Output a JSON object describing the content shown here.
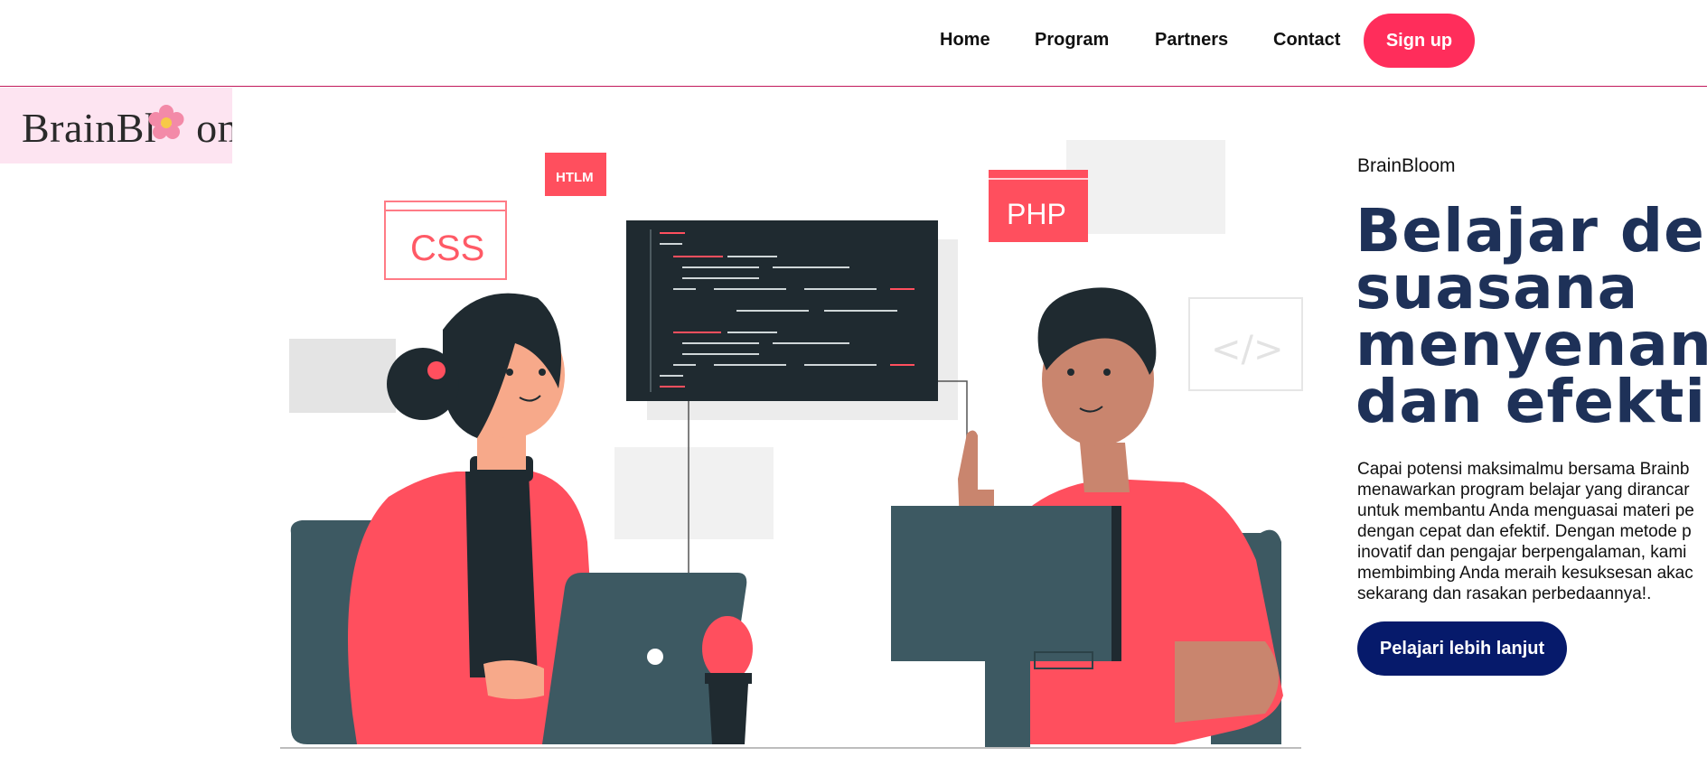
{
  "nav": {
    "links": [
      "Home",
      "Program",
      "Partners",
      "Contact"
    ],
    "signup_label": "Sign up"
  },
  "logo": {
    "text_left": "BrainBl",
    "text_right": "om"
  },
  "hero": {
    "brand": "BrainBloom",
    "title_lines": [
      "Belajar den",
      "suasana",
      "menyenang",
      "dan efektif"
    ],
    "description": "Capai potensi maksimalmu bersama Brainb menawarkan program belajar yang diranca untuk membantu Anda menguasai materi pe dengan cepat dan efektif. Dengan metode p inovatif dan pengajar berpengalaman, kami membimbing Anda meraih kesuksesan akad sekarang dan rasakan perbedaannya!.",
    "description_lines": [
      "Capai potensi maksimalmu bersama Brainb",
      "menawarkan program belajar yang dirancar",
      "untuk membantu Anda menguasai materi pe",
      "dengan cepat dan efektif. Dengan metode p",
      "inovatif dan pengajar berpengalaman, kami",
      "membimbing Anda meraih kesuksesan akac",
      "sekarang dan rasakan perbedaannya!."
    ],
    "cta_label": "Pelajari lebih lanjut"
  },
  "illustration": {
    "tags": {
      "css": "CSS",
      "html": "HTLM",
      "php": "PHP"
    }
  },
  "colors": {
    "accent": "#ff2d5b",
    "navy": "#1e3158",
    "cta": "#061a6b",
    "logo_bg": "#fde4f1",
    "illus_red": "#ff4f5e",
    "illus_dark": "#1f2a30",
    "illus_slate": "#3d5962"
  }
}
